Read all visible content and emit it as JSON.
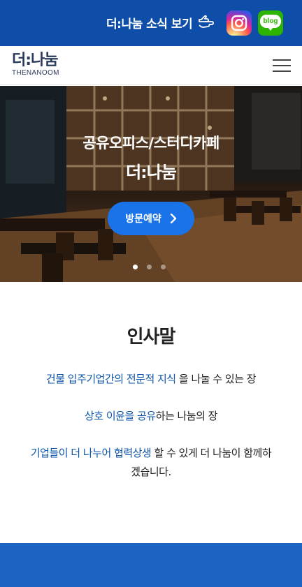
{
  "topbar": {
    "news_label": "더:나눔 소식 보기",
    "hand_icon": "pointing-hand-icon",
    "instagram_icon": "instagram-icon",
    "blog_label": "blog",
    "colors": {
      "background": "#0e4ea8"
    }
  },
  "header": {
    "logo_ko": "더:나눔",
    "logo_en": "THENANOOM",
    "menu_icon": "hamburger-menu-icon"
  },
  "hero": {
    "title": "공유오피스/스터디카페",
    "brand": "더:나눔",
    "visit_button": "방문예약",
    "slides": 3,
    "active_slide": 1,
    "colors": {
      "button": "#1a73e8"
    }
  },
  "greeting": {
    "title": "인사말",
    "line1": {
      "highlight": "건물 입주기업간의 전문적 지식",
      "rest": " 을 나눌 수 있는 장"
    },
    "line2": {
      "highlight": "상호 이윤을 공유",
      "rest": "하는 나눔의 장"
    },
    "line3": {
      "highlight": "기업들이 더 나누어 협력상생",
      "rest": " 할 수 있게 더 나눔이 함께하",
      "rest2": "겠습니다."
    },
    "colors": {
      "highlight": "#0d55a8"
    }
  },
  "footer": {
    "colors": {
      "background": "#1f63c2"
    }
  }
}
